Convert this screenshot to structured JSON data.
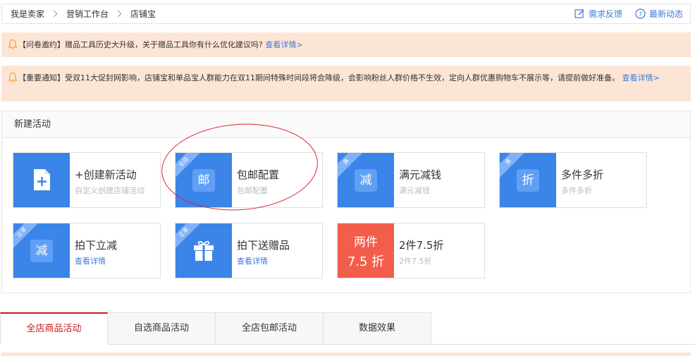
{
  "breadcrumb": {
    "items": [
      "我是卖家",
      "营销工作台",
      "店铺宝"
    ]
  },
  "top_actions": {
    "feedback": "需求反馈",
    "news": "最新动态"
  },
  "notices": [
    {
      "text": "【问卷邀约】赠品工具历史大升级，关于赠品工具你有什么优化建议吗?",
      "link": "查看详情>"
    },
    {
      "text": "【重要通知】受双11大促封网影响，店铺宝和单品宝人群能力在双11期间特殊时间段将会降级，会影响粉丝人群价格不生效，定向人群优惠购物车不展示等，请提前做好准备。",
      "link": "查看详情>"
    }
  ],
  "panel": {
    "title": "新建活动",
    "cards": [
      {
        "title": "+创建新活动",
        "sub": "自定义创建店铺活动",
        "icon": "document-plus-icon",
        "glyph": "+",
        "ribbon": ""
      },
      {
        "title": "包邮配置",
        "sub": "包邮配置",
        "icon": "free-shipping-icon",
        "glyph": "邮",
        "ribbon": "全店"
      },
      {
        "title": "满元减钱",
        "sub": "满元减钱",
        "icon": "discount-minus-icon",
        "glyph": "减",
        "ribbon": "满"
      },
      {
        "title": "多件多折",
        "sub": "多件多折",
        "icon": "multi-discount-icon",
        "glyph": "折",
        "ribbon": "满"
      },
      {
        "title": "拍下立减",
        "sub": "查看详情",
        "icon": "instant-minus-icon",
        "glyph": "减",
        "ribbon": "立享"
      },
      {
        "title": "拍下送赠品",
        "sub": "查看详情",
        "icon": "gift-icon",
        "glyph": "",
        "ribbon": "立享"
      },
      {
        "title": "2件7.5折",
        "sub": "2件7.5折",
        "icon": "promo-badge",
        "promo_l1": "两件",
        "promo_l2": "7.5 折"
      }
    ]
  },
  "tabs": [
    {
      "label": "全店商品活动",
      "active": true
    },
    {
      "label": "自选商品活动",
      "active": false
    },
    {
      "label": "全店包邮活动",
      "active": false
    },
    {
      "label": "数据效果",
      "active": false
    }
  ],
  "colors": {
    "accent_blue": "#3b84e8",
    "link_blue": "#3d7ad9",
    "notice_bg": "#fde5d5",
    "active_tab": "#c41d1d",
    "promo_red": "#f35d4c",
    "annotation_red": "#d8222c"
  }
}
